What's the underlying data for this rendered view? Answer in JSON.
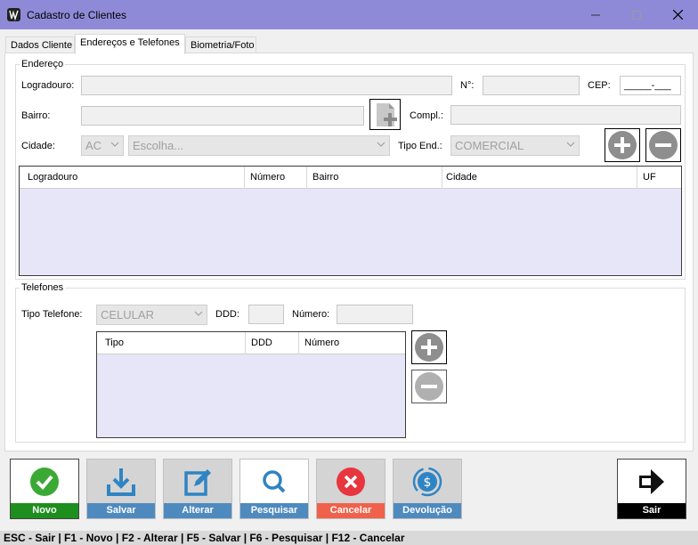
{
  "window": {
    "title": "Cadastro de Clientes"
  },
  "tabs": [
    "Dados Cliente",
    "Endereços e Telefones",
    "Biometria/Foto"
  ],
  "endereco": {
    "legend": "Endereço",
    "logradouro_label": "Logradouro:",
    "numero_label": "N°:",
    "cep_label": "CEP:",
    "cep_placeholder": "_____-___",
    "bairro_label": "Bairro:",
    "compl_label": "Compl.:",
    "cidade_label": "Cidade:",
    "uf_value": "AC",
    "cidade_value": "Escolha...",
    "tipo_end_label": "Tipo End.:",
    "tipo_end_value": "COMERCIAL",
    "grid_columns": [
      "Logradouro",
      "Número",
      "Bairro",
      "Cidade",
      "UF"
    ]
  },
  "telefones": {
    "legend": "Telefones",
    "tipo_label": "Tipo Telefone:",
    "tipo_value": "CELULAR",
    "ddd_label": "DDD:",
    "numero_label": "Número:",
    "grid_columns": [
      "Tipo",
      "DDD",
      "Número"
    ]
  },
  "footer_buttons": [
    {
      "label": "Novo",
      "color": "#1e8f1e"
    },
    {
      "label": "Salvar",
      "color": "#4f8abf"
    },
    {
      "label": "Alterar",
      "color": "#4f8abf"
    },
    {
      "label": "Pesquisar",
      "color": "#4f8abf"
    },
    {
      "label": "Cancelar",
      "color": "#f0614b"
    },
    {
      "label": "Devolução",
      "color": "#4f8abf"
    },
    {
      "label": "Sair",
      "color": "#000000"
    }
  ],
  "status": "ESC - Sair  |  F1 - Novo  |  F2 - Alterar  |  F5 - Salvar  |  F6 - Pesquisar  |  F12 - Cancelar",
  "icons": {
    "app": "app-logo-icon",
    "minimize": "minimize-icon",
    "maximize": "maximize-icon",
    "close": "close-icon",
    "new_doc": "add-document-icon",
    "add": "plus-circle-icon",
    "remove": "minus-circle-icon"
  }
}
